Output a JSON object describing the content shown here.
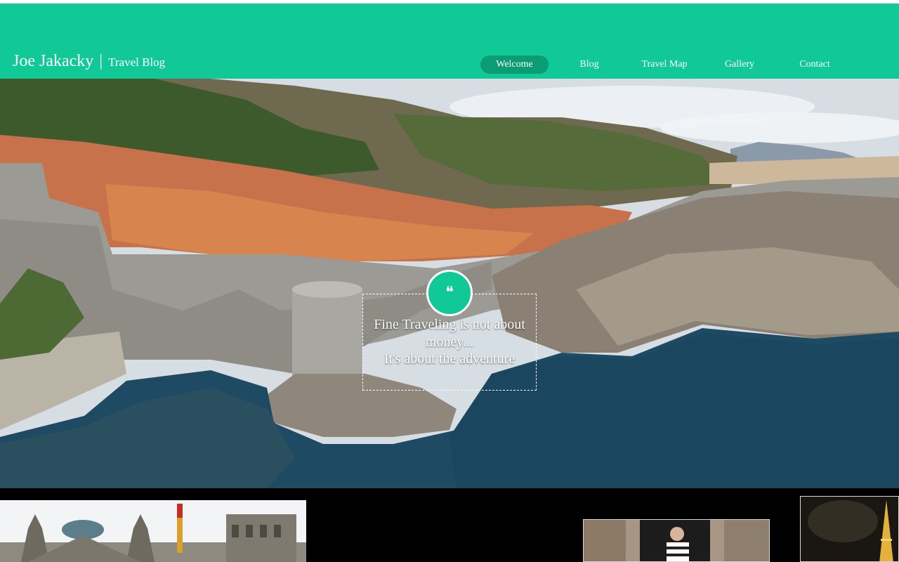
{
  "header": {
    "brand_name": "Joe Jakacky",
    "brand_separator": "|",
    "brand_tagline": "Travel Blog"
  },
  "nav": {
    "items": [
      {
        "label": "Welcome",
        "active": true
      },
      {
        "label": "Blog",
        "active": false
      },
      {
        "label": "Travel Map",
        "active": false
      },
      {
        "label": "Gallery",
        "active": false
      },
      {
        "label": "Contact",
        "active": false
      }
    ]
  },
  "hero": {
    "icon": "quote-icon",
    "quote_line1": "Fine Traveling is not  about money...",
    "quote_line2": "It's about the adventure"
  },
  "gallery": {
    "thumbs": [
      "building-photo",
      "street-photo",
      "tower-photo"
    ]
  },
  "colors": {
    "accent": "#10c996",
    "accent_dark": "#0b9c74",
    "strip_bg": "#000000"
  }
}
